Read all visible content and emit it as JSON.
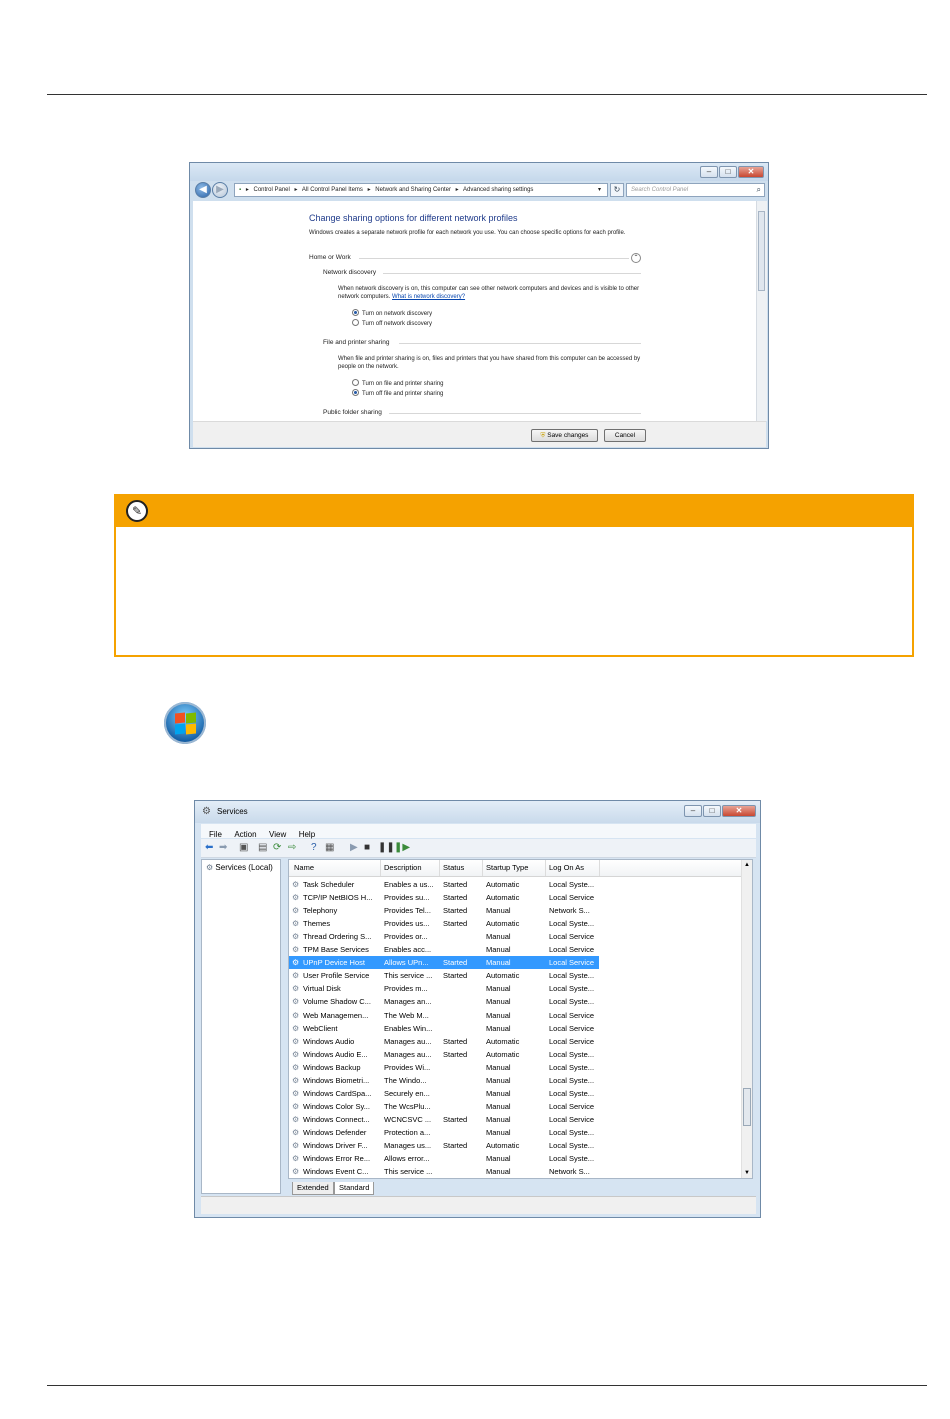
{
  "sharing_window": {
    "nav": {
      "back_icon": "back-arrow-icon",
      "forward_icon": "forward-arrow-icon"
    },
    "breadcrumb": [
      "Control Panel",
      "All Control Panel Items",
      "Network and Sharing Center",
      "Advanced sharing settings"
    ],
    "search_placeholder": "Search Control Panel",
    "title": "Change sharing options for different network profiles",
    "intro": "Windows creates a separate network profile for each network you use. You can choose specific options for each profile.",
    "profile": "Home or Work",
    "network_discovery": {
      "heading": "Network discovery",
      "desc": "When network discovery is on, this computer can see other network computers and devices and is visible to other network computers.",
      "link": "What is network discovery?",
      "options": [
        {
          "label": "Turn on network discovery",
          "selected": true
        },
        {
          "label": "Turn off network discovery",
          "selected": false
        }
      ]
    },
    "file_sharing": {
      "heading": "File and printer sharing",
      "desc": "When file and printer sharing is on, files and printers that you have shared from this computer can be accessed by people on the network.",
      "options": [
        {
          "label": "Turn on file and printer sharing",
          "selected": false
        },
        {
          "label": "Turn off file and printer sharing",
          "selected": true
        }
      ]
    },
    "public_folder_heading": "Public folder sharing",
    "save_label": "Save changes",
    "cancel_label": "Cancel"
  },
  "services_window": {
    "title": "Services",
    "menu": [
      "File",
      "Action",
      "View",
      "Help"
    ],
    "tree_item": "Services (Local)",
    "columns": [
      "Name",
      "Description",
      "Status",
      "Startup Type",
      "Log On As"
    ],
    "rows": [
      [
        "Task Scheduler",
        "Enables a us...",
        "Started",
        "Automatic",
        "Local Syste..."
      ],
      [
        "TCP/IP NetBIOS H...",
        "Provides su...",
        "Started",
        "Automatic",
        "Local Service"
      ],
      [
        "Telephony",
        "Provides Tel...",
        "Started",
        "Manual",
        "Network S..."
      ],
      [
        "Themes",
        "Provides us...",
        "Started",
        "Automatic",
        "Local Syste..."
      ],
      [
        "Thread Ordering S...",
        "Provides or...",
        "",
        "Manual",
        "Local Service"
      ],
      [
        "TPM Base Services",
        "Enables acc...",
        "",
        "Manual",
        "Local Service"
      ],
      [
        "UPnP Device Host",
        "Allows UPn...",
        "Started",
        "Manual",
        "Local Service"
      ],
      [
        "User Profile Service",
        "This service ...",
        "Started",
        "Automatic",
        "Local Syste..."
      ],
      [
        "Virtual Disk",
        "Provides m...",
        "",
        "Manual",
        "Local Syste..."
      ],
      [
        "Volume Shadow C...",
        "Manages an...",
        "",
        "Manual",
        "Local Syste..."
      ],
      [
        "Web Managemen...",
        "The Web M...",
        "",
        "Manual",
        "Local Service"
      ],
      [
        "WebClient",
        "Enables Win...",
        "",
        "Manual",
        "Local Service"
      ],
      [
        "Windows Audio",
        "Manages au...",
        "Started",
        "Automatic",
        "Local Service"
      ],
      [
        "Windows Audio E...",
        "Manages au...",
        "Started",
        "Automatic",
        "Local Syste..."
      ],
      [
        "Windows Backup",
        "Provides Wi...",
        "",
        "Manual",
        "Local Syste..."
      ],
      [
        "Windows Biometri...",
        "The Windo...",
        "",
        "Manual",
        "Local Syste..."
      ],
      [
        "Windows CardSpa...",
        "Securely en...",
        "",
        "Manual",
        "Local Syste..."
      ],
      [
        "Windows Color Sy...",
        "The WcsPlu...",
        "",
        "Manual",
        "Local Service"
      ],
      [
        "Windows Connect...",
        "WCNCSVC ...",
        "Started",
        "Manual",
        "Local Service"
      ],
      [
        "Windows Defender",
        "Protection a...",
        "",
        "Manual",
        "Local Syste..."
      ],
      [
        "Windows Driver F...",
        "Manages us...",
        "Started",
        "Automatic",
        "Local Syste..."
      ],
      [
        "Windows Error Re...",
        "Allows error...",
        "",
        "Manual",
        "Local Syste..."
      ],
      [
        "Windows Event C...",
        "This service ...",
        "",
        "Manual",
        "Network S..."
      ]
    ],
    "selected_row": 6,
    "tabs": [
      "Extended",
      "Standard"
    ],
    "active_tab": "Standard",
    "selection_color": "#3399ff"
  },
  "note_box": {
    "accent": "#f5a200",
    "icon": "pen-nib-icon"
  },
  "orb": {
    "icon": "windows-start-orb-icon"
  }
}
